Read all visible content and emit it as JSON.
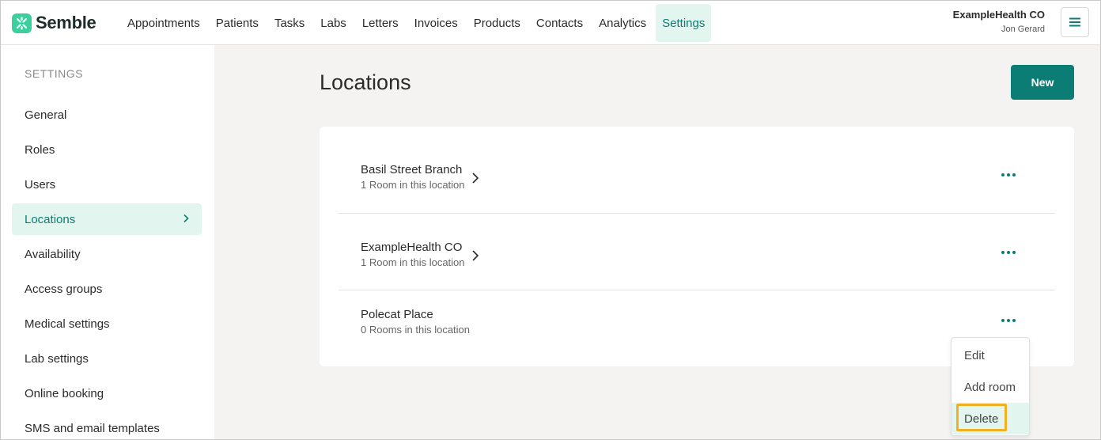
{
  "brand": {
    "name": "Semble",
    "accent": "#0b7d74",
    "logo_color": "#3ccf9e"
  },
  "nav": {
    "items": [
      {
        "label": "Appointments",
        "active": false
      },
      {
        "label": "Patients",
        "active": false
      },
      {
        "label": "Tasks",
        "active": false
      },
      {
        "label": "Labs",
        "active": false
      },
      {
        "label": "Letters",
        "active": false
      },
      {
        "label": "Invoices",
        "active": false
      },
      {
        "label": "Products",
        "active": false
      },
      {
        "label": "Contacts",
        "active": false
      },
      {
        "label": "Analytics",
        "active": false
      },
      {
        "label": "Settings",
        "active": true
      }
    ]
  },
  "user": {
    "organisation": "ExampleHealth CO",
    "name": "Jon Gerard",
    "menu_icon": "hamburger-icon"
  },
  "sidebar": {
    "heading": "SETTINGS",
    "items": [
      {
        "label": "General",
        "active": false
      },
      {
        "label": "Roles",
        "active": false
      },
      {
        "label": "Users",
        "active": false
      },
      {
        "label": "Locations",
        "active": true
      },
      {
        "label": "Availability",
        "active": false
      },
      {
        "label": "Access groups",
        "active": false
      },
      {
        "label": "Medical settings",
        "active": false
      },
      {
        "label": "Lab settings",
        "active": false
      },
      {
        "label": "Online booking",
        "active": false
      },
      {
        "label": "SMS and email templates",
        "active": false
      }
    ]
  },
  "main": {
    "title": "Locations",
    "new_button": "New",
    "locations": [
      {
        "name": "Basil Street Branch",
        "rooms": "1 Room in this location",
        "has_chevron": true
      },
      {
        "name": "ExampleHealth CO",
        "rooms": "1 Room in this location",
        "has_chevron": true
      },
      {
        "name": "Polecat Place",
        "rooms": "0 Rooms in this location",
        "has_chevron": false
      }
    ]
  },
  "dropdown": {
    "items": [
      "Edit",
      "Add room",
      "Delete"
    ],
    "hovered": "Delete",
    "highlight_color": "#f2b01e"
  }
}
